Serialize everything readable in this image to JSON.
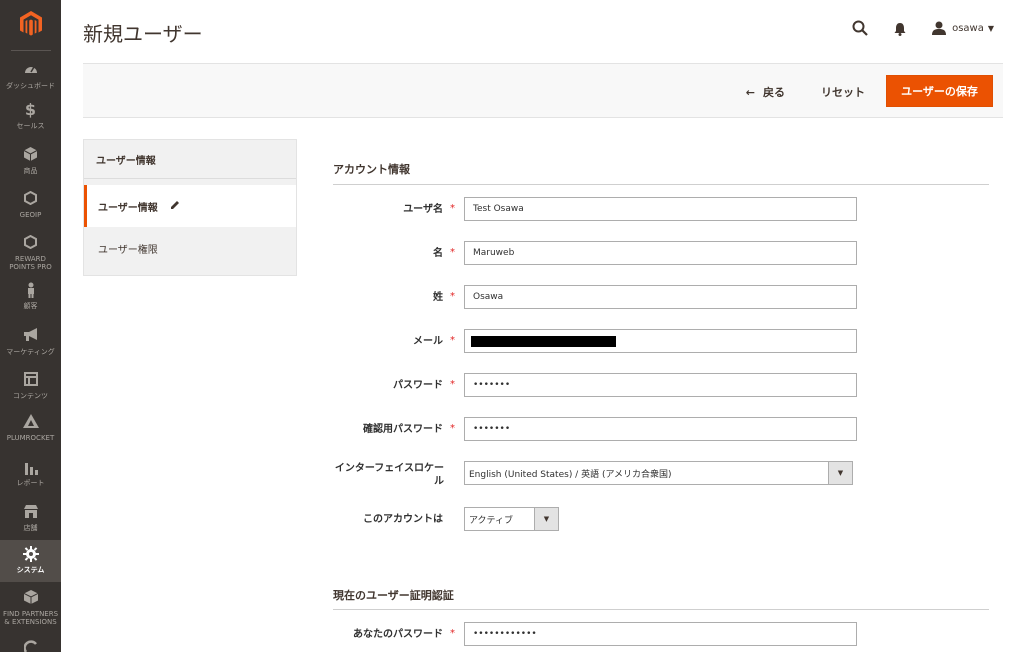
{
  "app": {
    "title": "新規ユーザー",
    "accent_color": "#eb5202",
    "sidebar_color": "#373330"
  },
  "sidebar": {
    "logo_icon": "magento-logo",
    "items": [
      {
        "label": "ダッシュボード",
        "icon": "dashboard-icon"
      },
      {
        "label": "セールス",
        "icon": "dollar-icon"
      },
      {
        "label": "商品",
        "icon": "cube-icon"
      },
      {
        "label": "GEOIP",
        "icon": "hexagon-icon"
      },
      {
        "label": "REWARD\nPOINTS PRO",
        "icon": "hexagon-icon"
      },
      {
        "label": "顧客",
        "icon": "person-icon"
      },
      {
        "label": "マーケティング",
        "icon": "megaphone-icon"
      },
      {
        "label": "コンテンツ",
        "icon": "layout-icon"
      },
      {
        "label": "PLUMROCKET",
        "icon": "rocket-icon"
      },
      {
        "label": "レポート",
        "icon": "bar-chart-icon"
      },
      {
        "label": "店舗",
        "icon": "store-icon"
      },
      {
        "label": "システム",
        "icon": "gear-icon"
      },
      {
        "label": "FIND PARTNERS\n& EXTENSIONS",
        "icon": "partners-icon"
      }
    ],
    "active_index": 11
  },
  "header": {
    "user_name": "osawa",
    "search_icon": "search-icon",
    "notifications_icon": "bell-icon"
  },
  "actions": {
    "back_label": "戻る",
    "reset_label": "リセット",
    "save_label": "ユーザーの保存"
  },
  "tabs": {
    "title": "ユーザー情報",
    "items": [
      {
        "label": "ユーザー情報",
        "active": true
      },
      {
        "label": "ユーザー権限",
        "active": false
      }
    ]
  },
  "account_section": {
    "title": "アカウント情報",
    "fields": {
      "username": {
        "label": "ユーザ名",
        "value": "Test Osawa",
        "required": true
      },
      "firstname": {
        "label": "名",
        "value": "Maruweb",
        "required": true
      },
      "lastname": {
        "label": "姓",
        "value": "Osawa",
        "required": true
      },
      "email": {
        "label": "メール",
        "value": "",
        "required": true
      },
      "password": {
        "label": "パスワード",
        "value": "•••••••",
        "required": true
      },
      "password_confirm": {
        "label": "確認用パスワード",
        "value": "•••••••",
        "required": true
      },
      "locale": {
        "label": "インターフェイスロケール",
        "value": "English (United States) / 英語 (アメリカ合衆国)"
      },
      "active": {
        "label": "このアカウントは",
        "value": "アクティブ"
      }
    }
  },
  "verify_section": {
    "title": "現在のユーザー証明認証",
    "fields": {
      "current_password": {
        "label": "あなたのパスワード",
        "value": "••••••••••••",
        "required": true
      }
    }
  },
  "required_mark": "*"
}
